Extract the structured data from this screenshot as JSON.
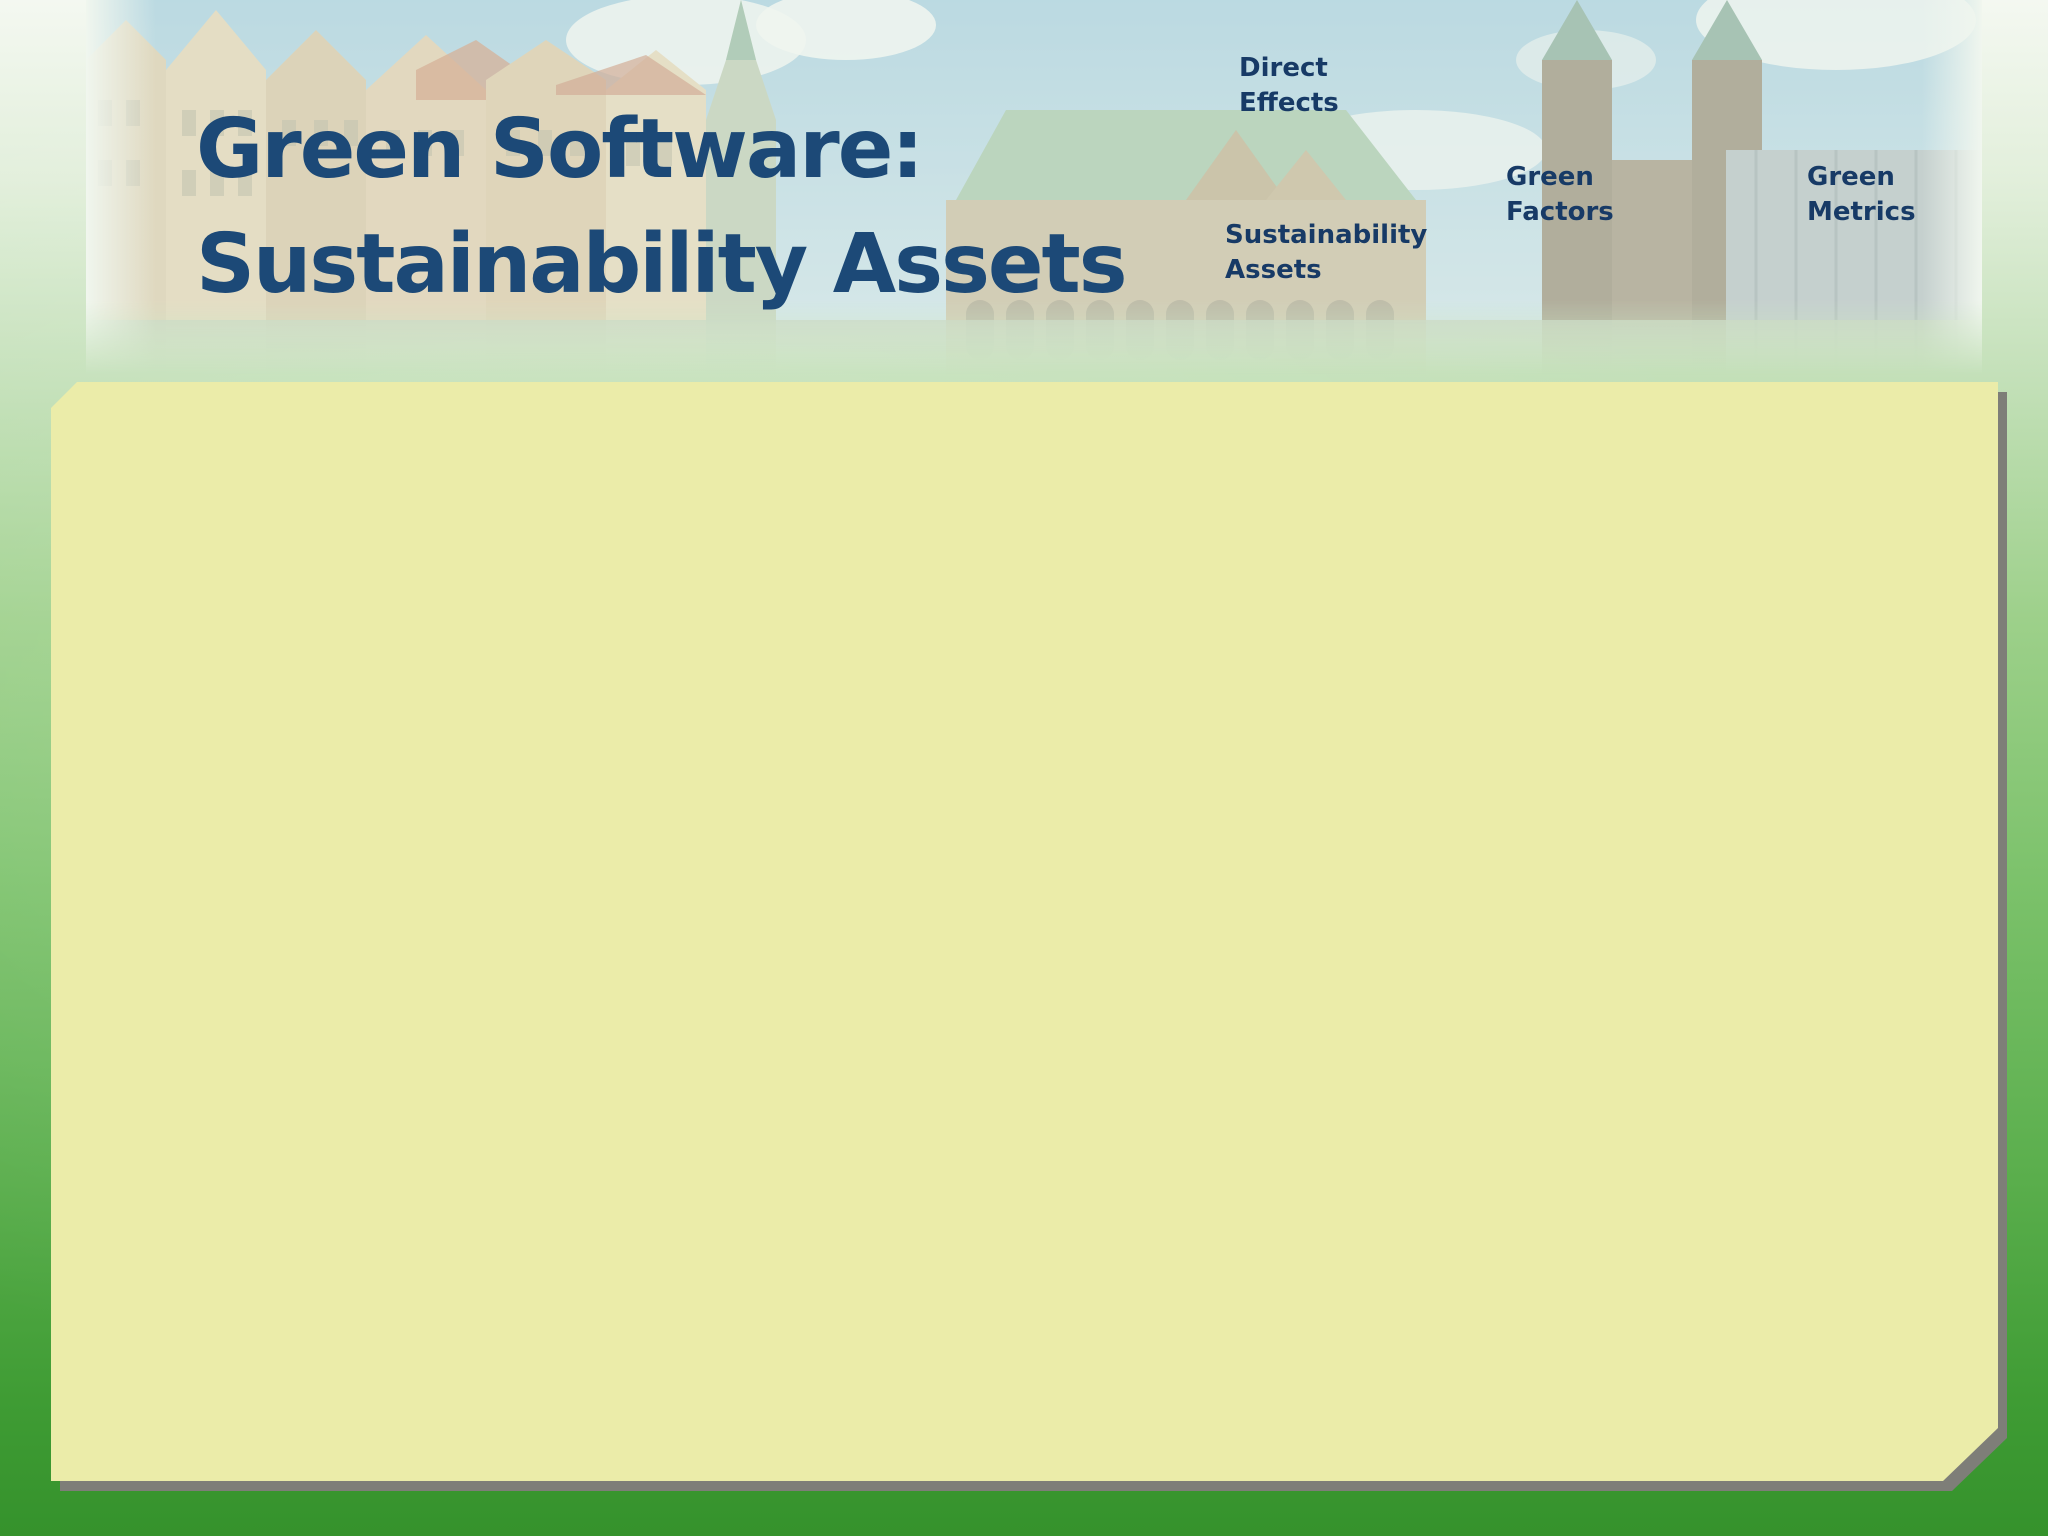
{
  "slide": {
    "title_line1": "Green Software:",
    "title_line2": "Sustainability Assets"
  },
  "nav": {
    "direct_effects": {
      "line1": "Direct",
      "line2": "Effects"
    },
    "green_factors": {
      "line1": "Green",
      "line2": "Factors"
    },
    "green_metrics": {
      "line1": "Green",
      "line2": "Metrics"
    },
    "sustainability_assets": {
      "line1": "Sustainability",
      "line2": "Assets"
    }
  },
  "colors": {
    "title": "#1c4977",
    "nav_text": "#173a66",
    "panel": "#ebeca9",
    "panel_shadow": "#7e7e78",
    "background_top": "#f4f8f1",
    "background_bottom": "#35922c"
  }
}
